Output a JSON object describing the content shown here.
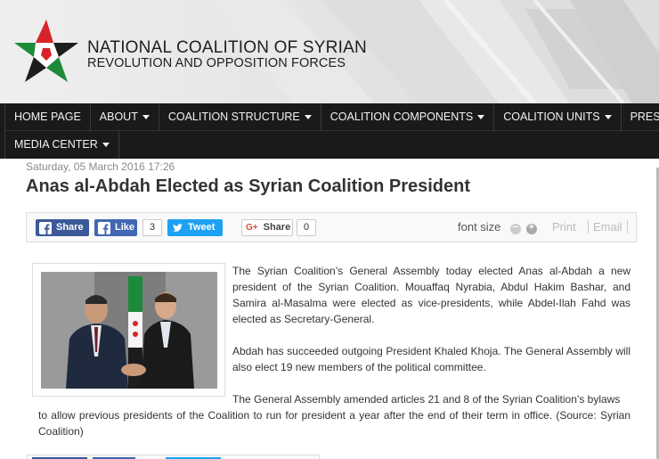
{
  "site": {
    "title_line1": "NATIONAL COALITION OF SYRIAN",
    "title_line2": "REVOLUTION AND OPPOSITION FORCES",
    "logo": "star-logo"
  },
  "nav": {
    "row1": [
      {
        "label": "HOME PAGE",
        "dropdown": false
      },
      {
        "label": "ABOUT",
        "dropdown": true
      },
      {
        "label": "COALITION STRUCTURE",
        "dropdown": true
      },
      {
        "label": "COALITION COMPONENTS",
        "dropdown": true
      },
      {
        "label": "COALITION UNITS",
        "dropdown": true
      },
      {
        "label": "PRESS RE",
        "dropdown": false
      }
    ],
    "row2": [
      {
        "label": "MEDIA CENTER",
        "dropdown": true
      }
    ]
  },
  "article": {
    "date": "Saturday, 05 March 2016 17:26",
    "title": "Anas al-Abdah Elected as Syrian Coalition President",
    "p1": "The Syrian Coalition’s General Assembly today elected Anas al-Abdah a new president of the Syrian Coalition. Mouaffaq Nyrabia, Abdul Hakim Bashar, and Samira al-Masalma were elected as vice-presidents, while Abdel-Ilah Fahd was elected as Secretary-General.",
    "p2": "Abdah has succeeded outgoing President Khaled Khoja. The General Assembly will also elect 19 new members of the political committee.",
    "p3": "The General Assembly amended articles 21 and 8 of the Syrian Coalition’s bylaws",
    "p4": "to allow previous presidents of the Coalition to run for president a year after the end of their term in office. (Source: Syrian Coalition)"
  },
  "share": {
    "fb_share": "Share",
    "fb_like": "Like",
    "like_count": "3",
    "tweet": "Tweet",
    "gplus_share": "Share",
    "gplus_count": "0"
  },
  "tools": {
    "font_size": "font size",
    "print": "Print",
    "email": "Email"
  },
  "colors": {
    "nav_bg": "#1a1a1a",
    "facebook": "#3b5998",
    "twitter": "#1da1f2",
    "logo_red": "#d8232a",
    "logo_green": "#1d8a3a"
  }
}
